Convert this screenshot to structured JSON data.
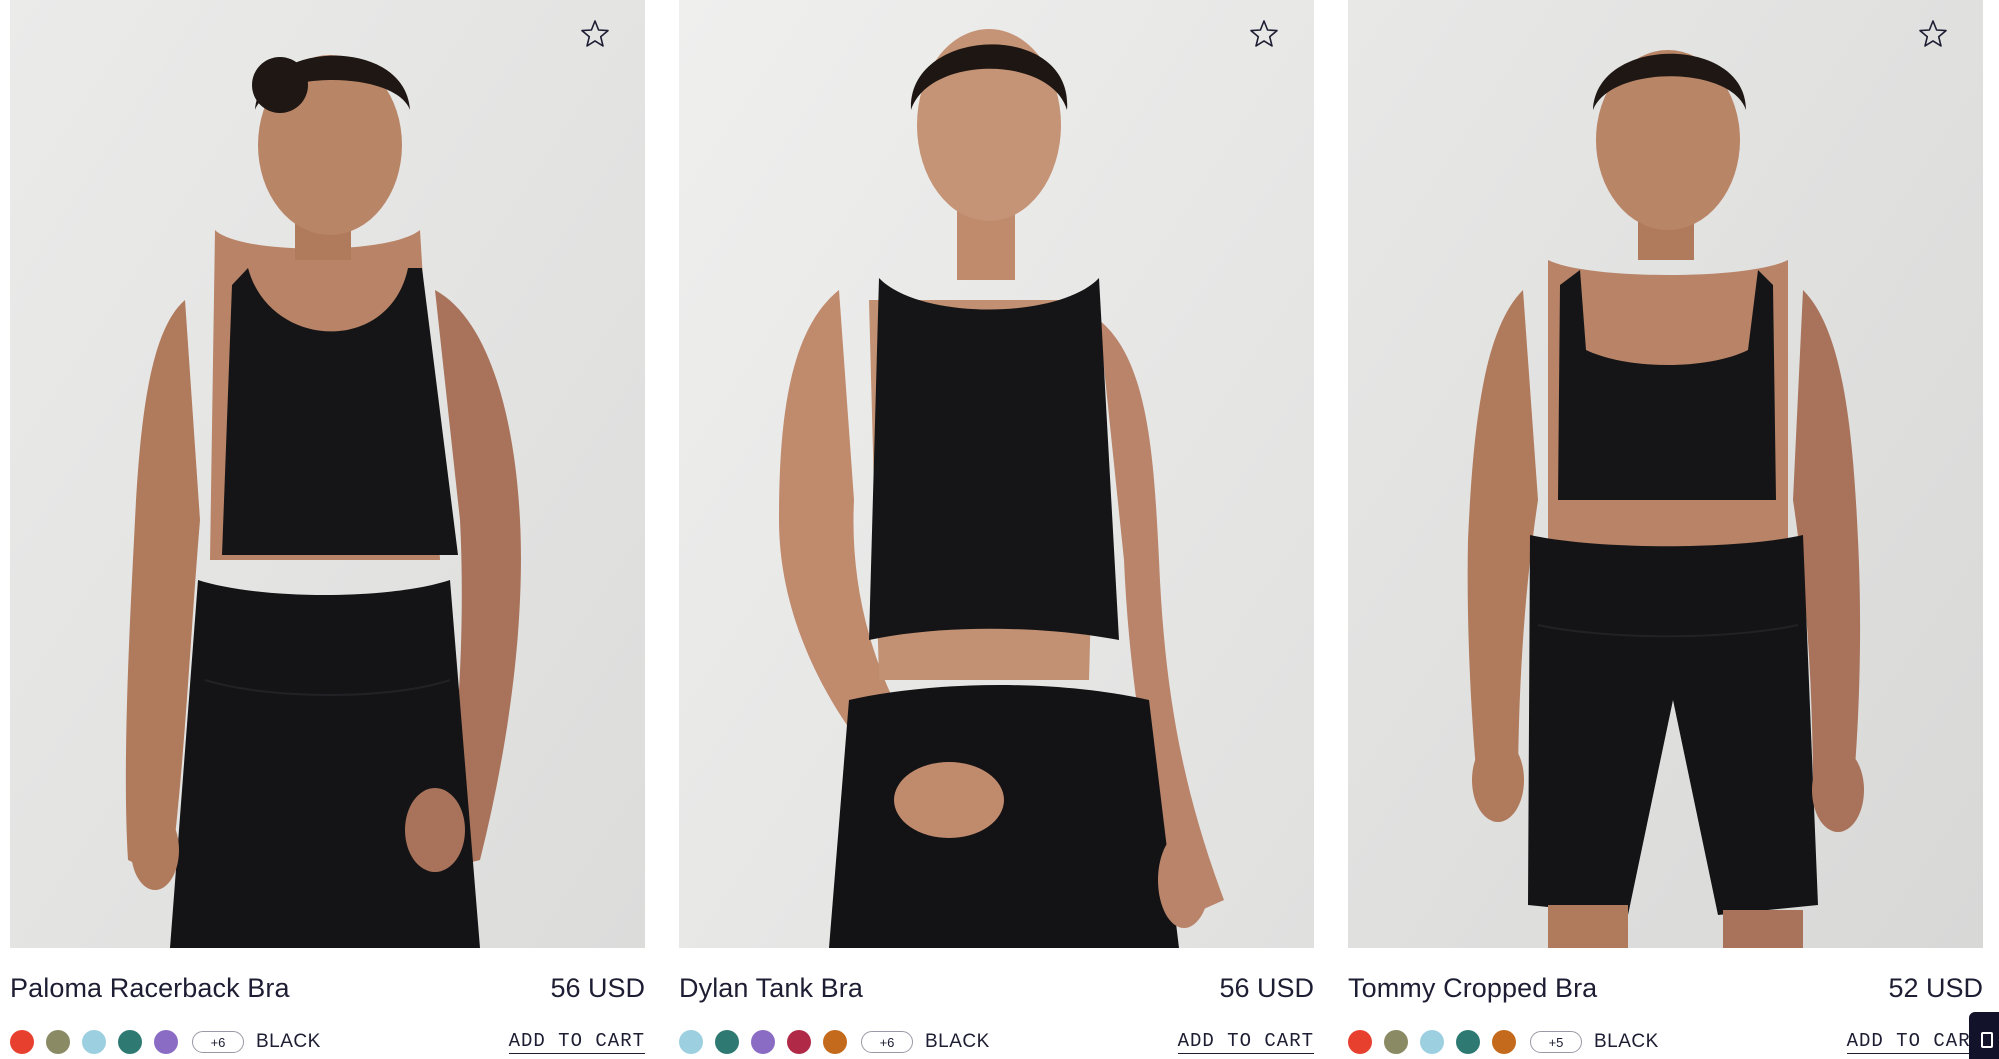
{
  "products": [
    {
      "name": "Paloma Racerback Bra",
      "price": "56 USD",
      "more_colors": "+6",
      "color_name": "BLACK",
      "add_to_cart": "ADD TO CART",
      "swatches": [
        "#e8402f",
        "#8a8a64",
        "#9ccfe0",
        "#2e7a72",
        "#8a6cc4"
      ],
      "favorite_icon": "star-outline-icon"
    },
    {
      "name": "Dylan Tank Bra",
      "price": "56 USD",
      "more_colors": "+6",
      "color_name": "BLACK",
      "add_to_cart": "ADD TO CART",
      "swatches": [
        "#9ccfe0",
        "#2e7a72",
        "#8a6cc4",
        "#b02a48",
        "#c46a1c"
      ],
      "favorite_icon": "star-outline-icon"
    },
    {
      "name": "Tommy Cropped Bra",
      "price": "52 USD",
      "more_colors": "+5",
      "color_name": "BLACK",
      "add_to_cart": "ADD TO CART",
      "swatches": [
        "#e8402f",
        "#8a8a64",
        "#9ccfe0",
        "#2e7a72",
        "#c46a1c"
      ],
      "favorite_icon": "star-outline-icon"
    }
  ],
  "colors": {
    "text": "#1d1d33",
    "garment": "#151517",
    "skin": "#b07a5c",
    "backdrop": "#e6e6e4",
    "chat_tab": "#12122b"
  }
}
